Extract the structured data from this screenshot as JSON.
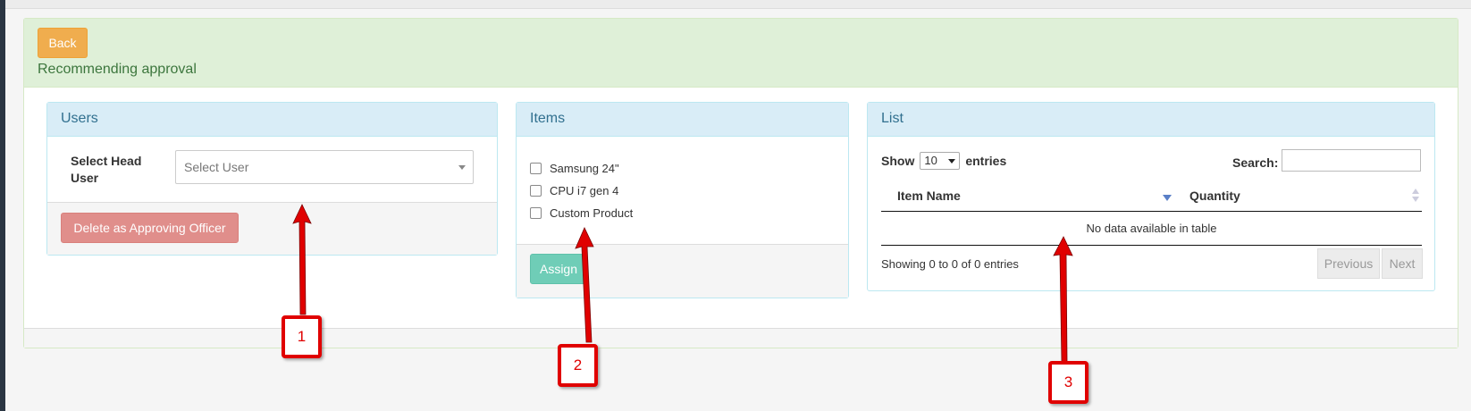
{
  "header": {
    "back_label": "Back",
    "title": "Recommending approval"
  },
  "users_panel": {
    "title": "Users",
    "select_label": "Select Head User",
    "select_placeholder": "Select User",
    "delete_label": "Delete as Approving Officer"
  },
  "items_panel": {
    "title": "Items",
    "items": [
      "Samsung 24\"",
      "CPU i7 gen 4",
      "Custom Product"
    ],
    "assign_label": "Assign"
  },
  "list_panel": {
    "title": "List",
    "show_label": "Show",
    "page_length": "10",
    "entries_label": "entries",
    "search_label": "Search:",
    "search_value": "",
    "columns": [
      "Item Name",
      "Quantity"
    ],
    "empty_message": "No data available in table",
    "info": "Showing 0 to 0 of 0 entries",
    "previous_label": "Previous",
    "next_label": "Next"
  },
  "callouts": [
    "1",
    "2",
    "3"
  ],
  "colors": {
    "warning": "#f0ad4e",
    "danger": "#e08e8b",
    "success": "#6fcdb7",
    "annotation_red": "#e00000"
  }
}
